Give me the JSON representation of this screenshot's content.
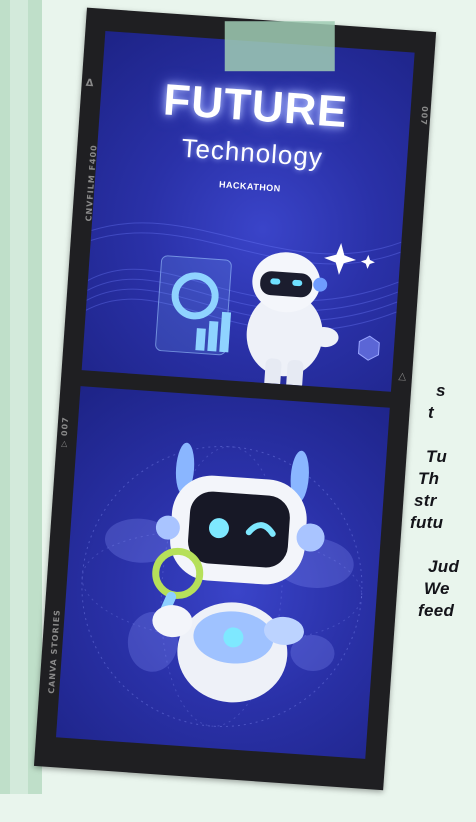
{
  "poster": {
    "title": "FUTURE",
    "subtitle": "Technology",
    "tagline": "HACKATHON"
  },
  "film_labels": {
    "top_left": "Δ",
    "cnv": "CNVFILM F400",
    "num_right": "007",
    "arrow_right": "▷",
    "num_left": "▷ 007",
    "stories": "CANVA STORIES"
  },
  "side_text": [
    "s",
    "t",
    "",
    "Tu",
    "Th",
    "str",
    "futu",
    "",
    "Jud",
    "We",
    "feed"
  ],
  "colors": {
    "background": "#e9f5ed",
    "frame_blue": "#2a31a8",
    "film": "#1f1f22"
  }
}
